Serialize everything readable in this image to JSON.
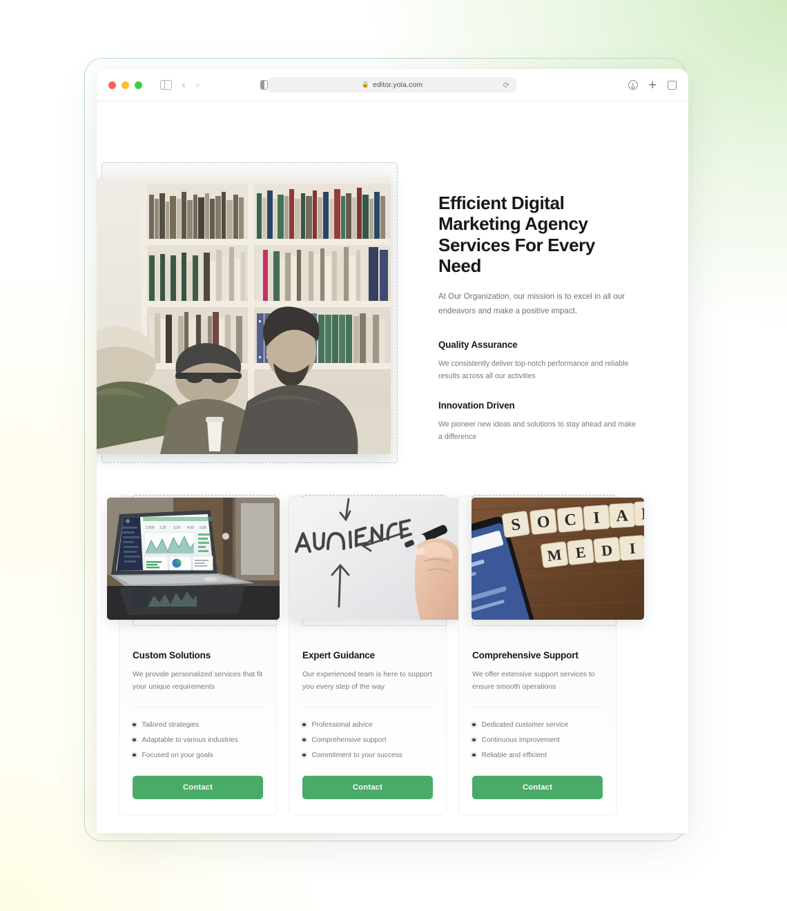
{
  "browser": {
    "url": "editor.yola.com",
    "lock_icon": "lock-icon",
    "reload_icon": "reload-icon",
    "back_icon": "chevron-left-icon",
    "forward_icon": "chevron-right-icon",
    "sidebar_icon": "sidebar-toggle-icon",
    "reader_icon": "reader-view-icon",
    "download_icon": "download-icon",
    "new_tab_icon": "plus-icon",
    "tab_overview_icon": "tab-overview-icon",
    "traffic_lights": [
      "close-red",
      "minimize-yellow",
      "maximize-green"
    ]
  },
  "hero": {
    "title": "Efficient Digital Marketing Agency Services For Every Need",
    "subtitle": "At Our Organization, our mission is to excel in all our endeavors and make a positive impact.",
    "features": [
      {
        "title": "Quality Assurance",
        "body": "We consistently deliver top-notch performance and reliable results across all our activities"
      },
      {
        "title": "Innovation Driven",
        "body": "We pioneer new ideas and solutions to stay ahead and make a difference"
      }
    ],
    "image_alt": "team-collaborating-in-library"
  },
  "cards": [
    {
      "title": "Custom Solutions",
      "description": "We provide personalized services that fit your unique requirements",
      "items": [
        "Tailored strategies",
        "Adaptable to various industries",
        "Focused on your goals"
      ],
      "button": "Contact",
      "image_alt": "laptop-showing-analytics-dashboard"
    },
    {
      "title": "Expert Guidance",
      "description": "Our experienced team is here to support you every step of the way",
      "items": [
        "Professional advice",
        "Comprehensive support",
        "Commitment to your success"
      ],
      "button": "Contact",
      "image_alt": "hand-writing-audience-on-whiteboard"
    },
    {
      "title": "Comprehensive Support",
      "description": "We offer extensive support services to ensure smooth operations",
      "items": [
        "Dedicated customer service",
        "Continuous improvement",
        "Reliable and efficient"
      ],
      "button": "Contact",
      "image_alt": "social-media-scrabble-tiles-with-phone"
    }
  ],
  "colors": {
    "accent_green": "#4aab68",
    "frame_outline": "#b6e3bd",
    "heading": "#17181a",
    "body_text": "#77797d",
    "selection_dash": "#c4c5c7"
  }
}
